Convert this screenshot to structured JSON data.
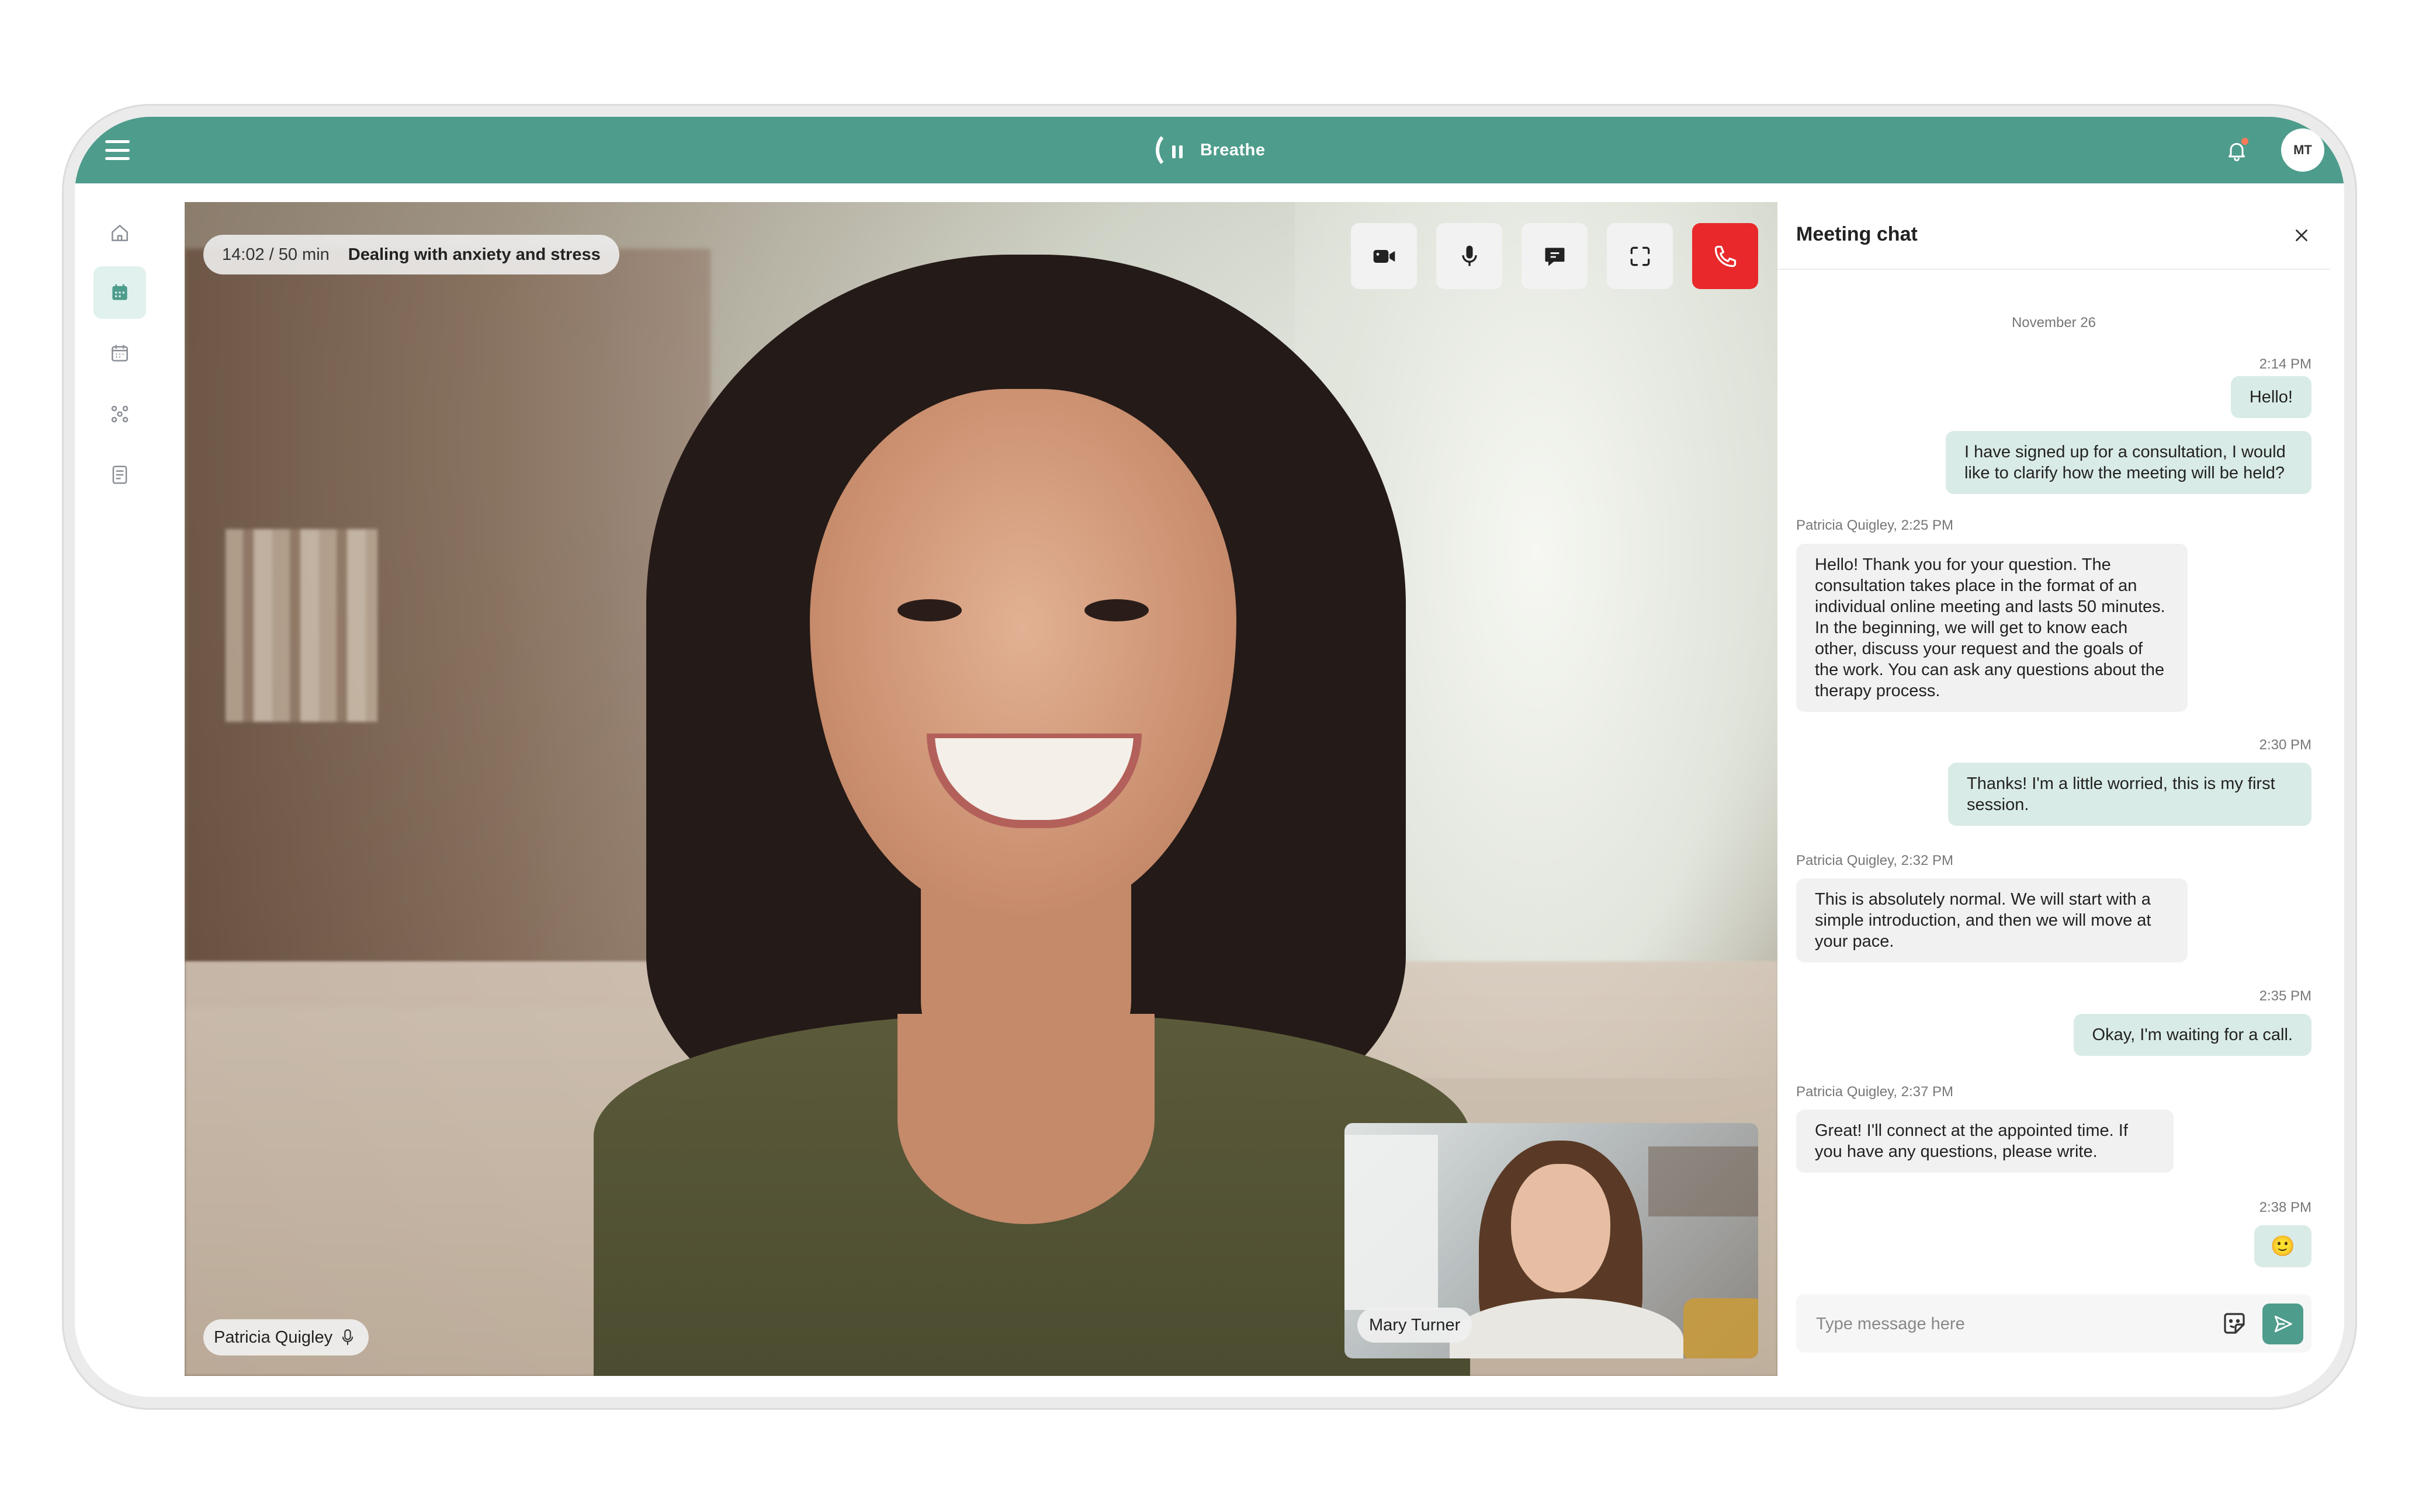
{
  "app": {
    "brand": "Breathe",
    "user_initials": "MT"
  },
  "session": {
    "time": "14:02 / 50 min",
    "topic": "Dealing with anxiety and stress"
  },
  "participants": {
    "main": "Patricia Quigley",
    "pip": "Mary Turner"
  },
  "icons": {
    "menu": "hamburger-icon",
    "bell": "bell-icon",
    "nav": [
      "home-icon",
      "calendar-check-icon",
      "calendar-icon",
      "group-icon",
      "notes-icon"
    ],
    "controls": [
      "video-camera-icon",
      "microphone-icon",
      "chat-bubble-icon",
      "fullscreen-icon",
      "phone-icon"
    ]
  },
  "colors": {
    "brand": "#4e9c8c",
    "end_call": "#e8282b",
    "outgoing_bubble": "#d9ebe6",
    "incoming_bubble": "#f1f1f1"
  },
  "chat": {
    "title": "Meeting chat",
    "date": "November 26",
    "messages": [
      {
        "meta": "2:14 PM",
        "text": "Hello!"
      },
      {
        "meta": "",
        "text": "I have signed up for a consultation, I would like to clarify how the meeting will be held?"
      },
      {
        "meta": "Patricia Quigley, 2:25 PM",
        "text": "Hello! Thank you for your question. The consultation takes place in the format of an individual online meeting and lasts 50 minutes. In the beginning, we will get to know each other, discuss your request and the goals of the work. You can ask any questions about the therapy process."
      },
      {
        "meta": "2:30 PM",
        "text": "Thanks! I'm a little worried, this is my first session."
      },
      {
        "meta": "Patricia Quigley, 2:32 PM",
        "text": "This is absolutely normal. We will start with a simple introduction, and then we will move at your pace."
      },
      {
        "meta": "2:35 PM",
        "text": "Okay, I'm waiting for a call."
      },
      {
        "meta": "Patricia Quigley, 2:37 PM",
        "text": "Great! I'll connect at the appointed time. If you have any questions, please write."
      },
      {
        "meta": "2:38 PM",
        "text": "🙂"
      }
    ],
    "input_placeholder": "Type message here",
    "input_value": ""
  }
}
